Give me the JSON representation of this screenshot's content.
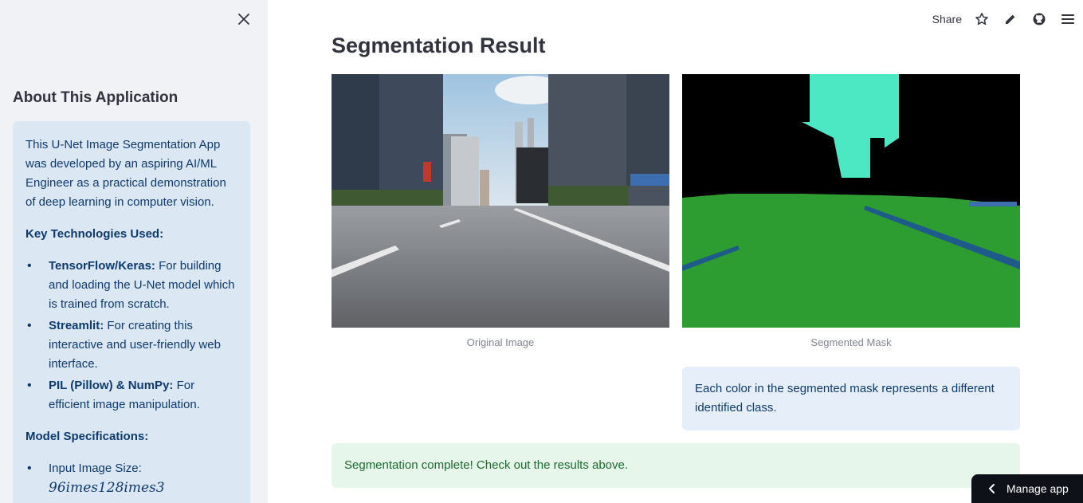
{
  "sidebar": {
    "heading": "About This Application",
    "intro": "This U-Net Image Segmentation App was developed by an aspiring AI/ML Engineer as a practical demonstration of deep learning in computer vision.",
    "key_tech_heading": "Key Technologies Used:",
    "technologies": [
      {
        "name": "TensorFlow/Keras:",
        "desc": " For building and loading the U-Net model which is trained from scratch."
      },
      {
        "name": "Streamlit:",
        "desc": " For creating this interactive and user-friendly web interface."
      },
      {
        "name": "PIL (Pillow) & NumPy:",
        "desc": " For efficient image manipulation."
      }
    ],
    "model_specs_heading": "Model Specifications:",
    "specs": [
      {
        "label": "Input Image Size:",
        "value": "96imes128imes3"
      }
    ]
  },
  "toolbar": {
    "share_label": "Share"
  },
  "main": {
    "title": "Segmentation Result",
    "original_caption": "Original Image",
    "mask_caption": "Segmented Mask",
    "mask_note": "Each color in the segmented mask represents a different identified class.",
    "success_message": "Segmentation complete! Check out the results above."
  },
  "manage_app": {
    "label": "Manage app"
  },
  "colors": {
    "sidebar_bg": "#f0f2f6",
    "info_bg": "#dce7f4",
    "info_text": "#0d3a6e",
    "success_bg": "#e7f6ea",
    "success_text": "#1d6a2e",
    "mask_road": "#2e9d31",
    "mask_sky": "#4ce8c4",
    "mask_building": "#000000"
  }
}
